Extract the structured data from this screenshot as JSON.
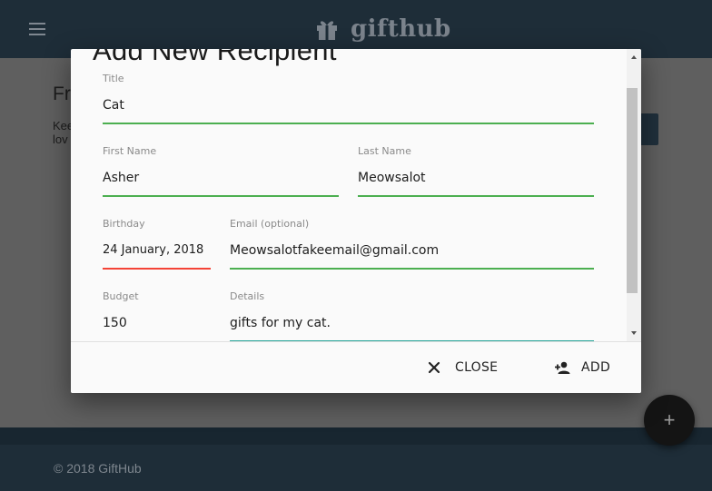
{
  "navbar": {
    "brand": "gifthub"
  },
  "background": {
    "heading": "Fr",
    "text_line1": "Kee",
    "text_line2": "lov"
  },
  "footer": {
    "copyright": "© 2018 GiftHub"
  },
  "fab": {
    "icon": "plus-icon",
    "label": "+"
  },
  "modal": {
    "title": "Add New Recipient",
    "fields": {
      "title": {
        "label": "Title",
        "value": "Cat"
      },
      "first_name": {
        "label": "First Name",
        "value": "Asher"
      },
      "last_name": {
        "label": "Last Name",
        "value": "Meowsalot"
      },
      "birthday": {
        "label": "Birthday",
        "value": "24 January, 2018"
      },
      "email": {
        "label": "Email (optional)",
        "value": "Meowsalotfakeemail@gmail.com"
      },
      "budget": {
        "label": "Budget",
        "value": "150"
      },
      "details": {
        "label": "Details",
        "value": "gifts for my cat."
      }
    },
    "actions": {
      "close": {
        "label": "CLOSE",
        "icon": "close-icon"
      },
      "add": {
        "label": "ADD",
        "icon": "person-add-icon"
      }
    }
  },
  "colors": {
    "valid_underline": "#4caf50",
    "invalid_underline": "#f44336",
    "active_underline": "#26a69a",
    "navbar": "#1e2d38"
  }
}
